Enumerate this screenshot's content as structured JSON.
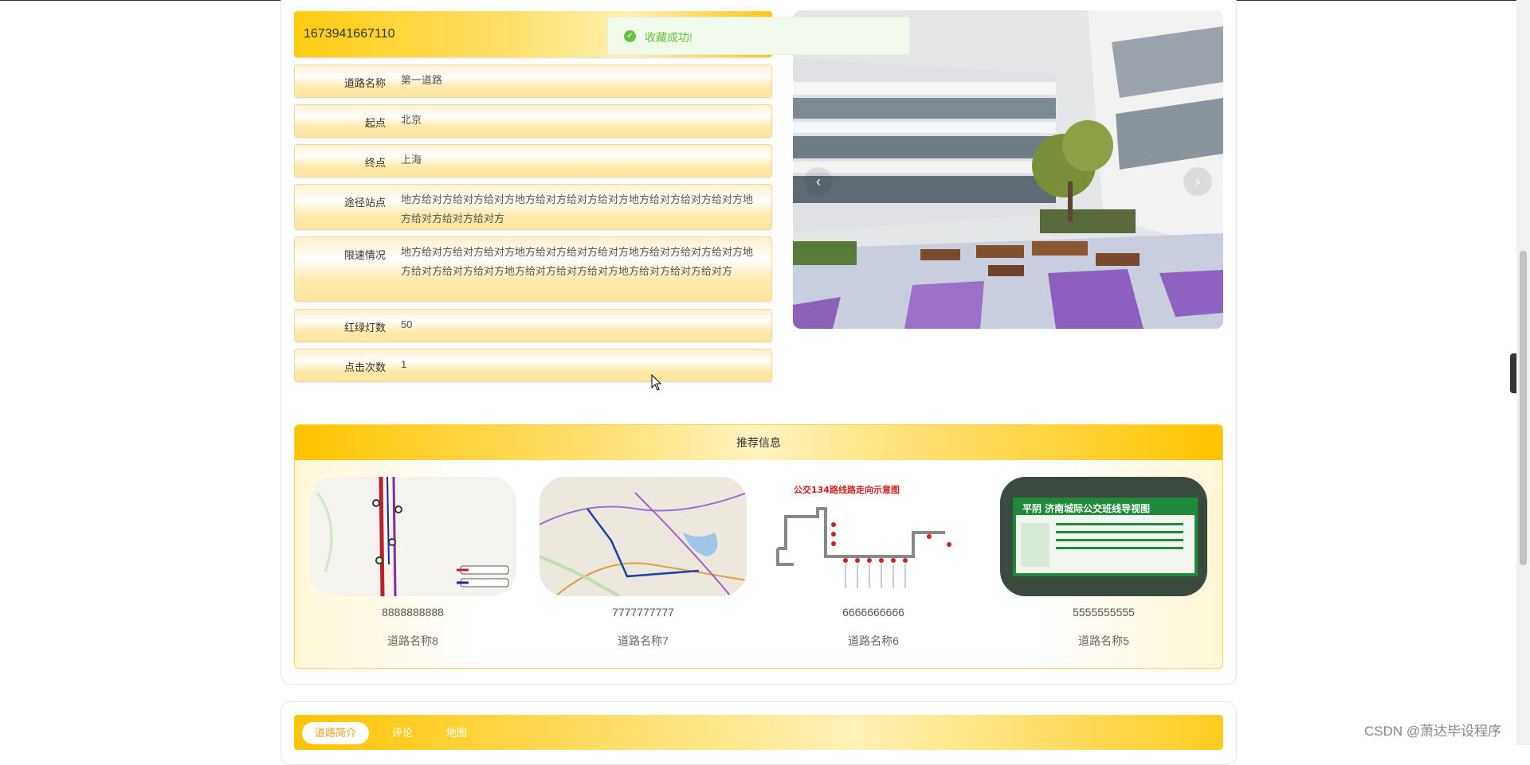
{
  "detail": {
    "id": "1673941667110",
    "fields": [
      {
        "label": "道路名称",
        "value": "第一道路"
      },
      {
        "label": "起点",
        "value": "北京"
      },
      {
        "label": "终点",
        "value": "上海"
      },
      {
        "label": "途径站点",
        "value": "地方给对方给对方给对方地方给对方给对方给对方地方给对方给对方给对方地方给对方给对方给对方"
      },
      {
        "label": "限速情况",
        "value": "地方给对方给对方给对方地方给对方给对方给对方地方给对方给对方给对方地方给对方给对方给对方地方给对方给对方给对方地方给对方给对方给对方"
      },
      {
        "label": "红绿灯数",
        "value": "50"
      },
      {
        "label": "点击次数",
        "value": "1"
      }
    ]
  },
  "toast": {
    "message": "收藏成功!"
  },
  "carousel": {
    "prev_arrow": "‹",
    "next_arrow": "›"
  },
  "recommend": {
    "title": "推荐信息",
    "items": [
      {
        "number": "8888888888",
        "name": "道路名称8"
      },
      {
        "number": "7777777777",
        "name": "道路名称7"
      },
      {
        "number": "6666666666",
        "name": "道路名称6",
        "image_title": "公交134路线路走向示意图"
      },
      {
        "number": "5555555555",
        "name": "道路名称5",
        "image_title": "平阴 济南城际公交班线导视图"
      }
    ]
  },
  "tabs": [
    {
      "label": "道路简介",
      "active": true
    },
    {
      "label": "评论",
      "active": false
    },
    {
      "label": "地图",
      "active": false
    }
  ],
  "watermark": "CSDN @萧达毕设程序",
  "colors": {
    "accent": "#ffc400",
    "success": "#67c23a"
  }
}
